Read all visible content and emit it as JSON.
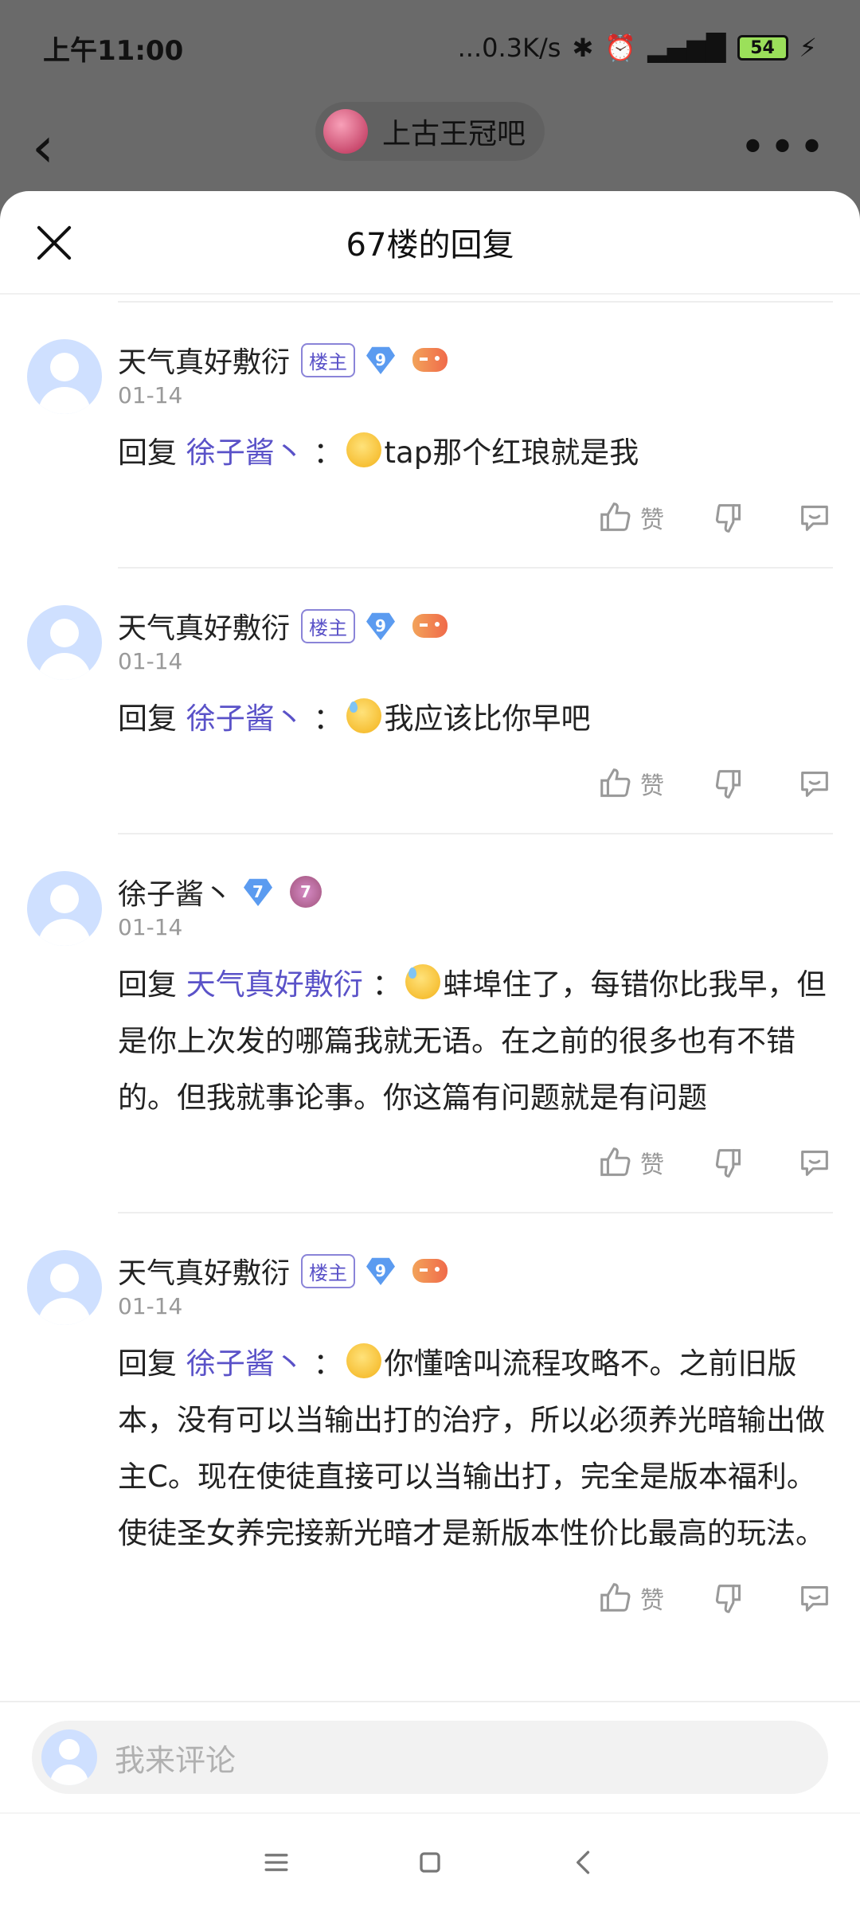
{
  "status_bar": {
    "time": "上午11:00",
    "net_speed": "...0.3K/s",
    "battery": "54"
  },
  "top_nav": {
    "forum_name": "上古王冠吧"
  },
  "sheet": {
    "title": "67楼的回复"
  },
  "replies": [
    {
      "username": "天气真好敷衍",
      "owner_badge": "楼主",
      "level": "9",
      "date": "01-14",
      "reply_prefix": "回复",
      "reply_to": "徐子酱丶",
      "text": "tap那个红琅就是我",
      "like_label": "赞",
      "emoji": "smile"
    },
    {
      "username": "天气真好敷衍",
      "owner_badge": "楼主",
      "level": "9",
      "date": "01-14",
      "reply_prefix": "回复",
      "reply_to": "徐子酱丶",
      "text": "我应该比你早吧",
      "like_label": "赞",
      "emoji": "sweat"
    },
    {
      "username": "徐子酱丶",
      "owner_badge": "",
      "level": "7",
      "date": "01-14",
      "reply_prefix": "回复",
      "reply_to": "天气真好敷衍",
      "text": "蚌埠住了，每错你比我早，但是你上次发的哪篇我就无语。在之前的很多也有不错的。但我就事论事。你这篇有问题就是有问题",
      "like_label": "赞",
      "emoji": "sweat"
    },
    {
      "username": "天气真好敷衍",
      "owner_badge": "楼主",
      "level": "9",
      "date": "01-14",
      "reply_prefix": "回复",
      "reply_to": "徐子酱丶",
      "text": "你懂啥叫流程攻略不。之前旧版本，没有可以当输出打的治疗，所以必须养光暗输出做主C。现在使徒直接可以当输出打，完全是版本福利。使徒圣女养完接新光暗才是新版本性价比最高的玩法。",
      "like_label": "赞",
      "emoji": "smile"
    }
  ],
  "comment_bar": {
    "placeholder": "我来评论"
  },
  "colors": {
    "accent": "#5a52c8",
    "avatar_bg": "#cfe0ff",
    "level_gem": "#5b9bf0"
  },
  "icons": [
    "back-arrow-icon",
    "more-dots-icon",
    "close-icon",
    "thumbs-up-icon",
    "thumbs-down-icon",
    "comment-icon",
    "menu-icon",
    "home-square-icon",
    "back-triangle-icon"
  ]
}
